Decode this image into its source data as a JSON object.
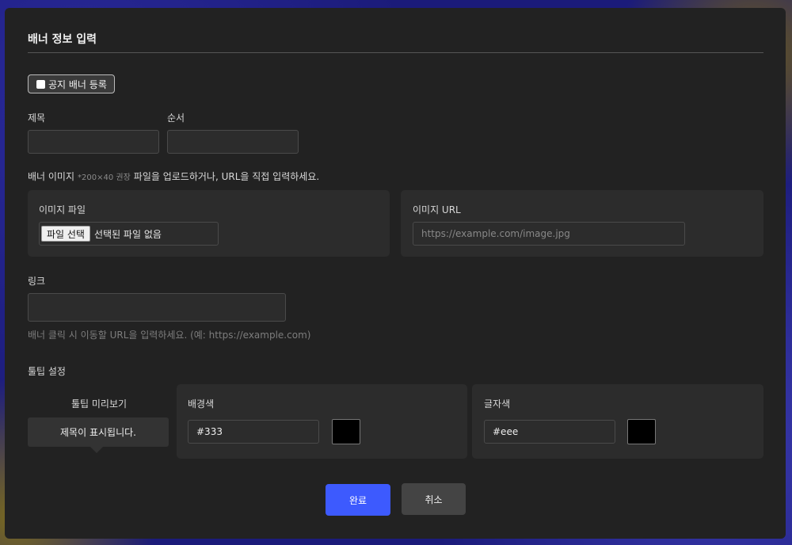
{
  "modal": {
    "title": "배너 정보 입력",
    "notice_checkbox_label": "공지 배너 등록",
    "fields": {
      "title_label": "제목",
      "title_value": "",
      "order_label": "순서",
      "order_value": "",
      "banner_image_label": "배너 이미지",
      "banner_image_size_hint": "*200×40 권장",
      "banner_image_instructions": "파일을 업로드하거나, URL을 직접 입력하세요.",
      "image_file_label": "이미지 파일",
      "file_choose_button": "파일 선택",
      "file_none_text": "선택된 파일 없음",
      "image_url_label": "이미지 URL",
      "image_url_placeholder": "https://example.com/image.jpg",
      "link_label": "링크",
      "link_value": "",
      "link_help": "배너 클릭 시 이동할 URL을 입력하세요. (예: https://example.com)"
    },
    "tooltip": {
      "section_label": "툴팁 설정",
      "preview_label": "툴팁 미리보기",
      "preview_text": "제목이 표시됩니다.",
      "bg_color_label": "배경색",
      "bg_color_value": "#333",
      "text_color_label": "글자색",
      "text_color_value": "#eee"
    },
    "buttons": {
      "confirm": "완료",
      "cancel": "취소"
    },
    "colors": {
      "primary": "#3d5afe",
      "modal_bg": "#222222"
    }
  }
}
